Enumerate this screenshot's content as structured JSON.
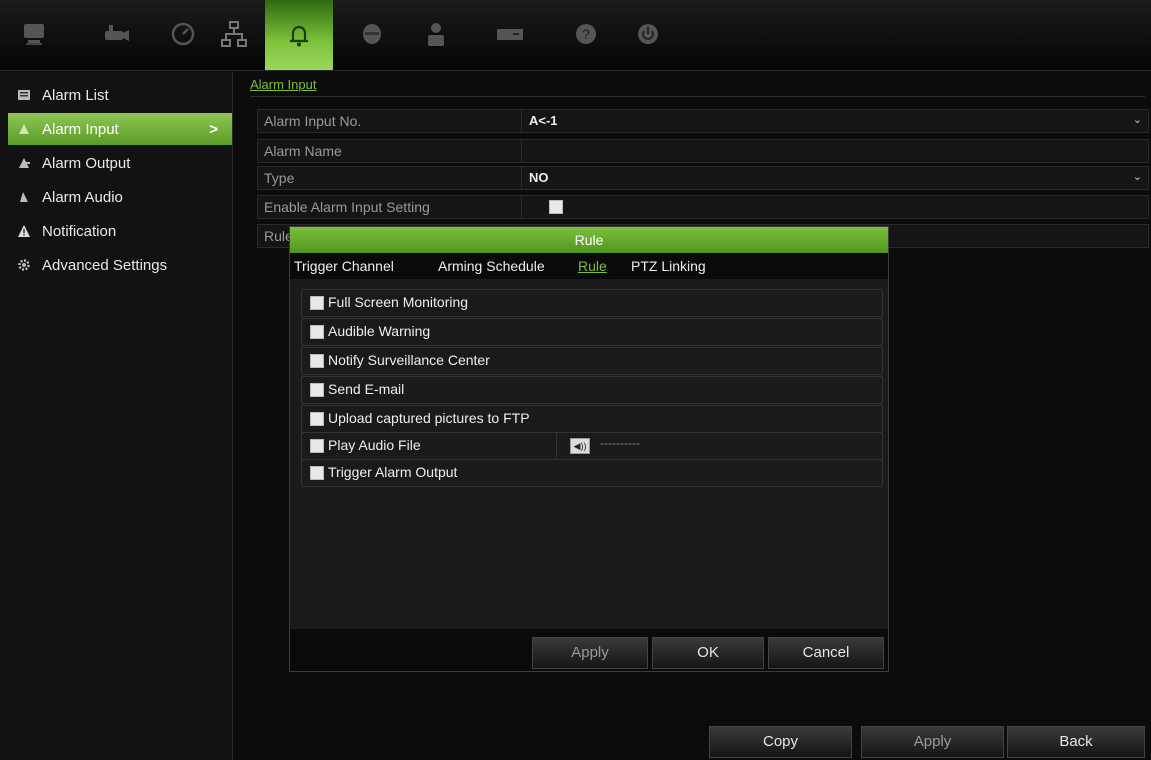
{
  "toolbar": {
    "icons": [
      "monitor-icon",
      "camera-icon",
      "gauge-icon",
      "network-icon",
      "bell-icon",
      "disk-icon",
      "user-icon",
      "storage-icon",
      "help-icon",
      "power-icon"
    ],
    "active_color": "#7dc33a"
  },
  "sidebar": {
    "items": [
      {
        "label": "Alarm List",
        "icon": "alarm-list-icon"
      },
      {
        "label": "Alarm Input",
        "icon": "alarm-input-icon",
        "active": true
      },
      {
        "label": "Alarm Output",
        "icon": "alarm-output-icon"
      },
      {
        "label": "Alarm Audio",
        "icon": "alarm-audio-icon"
      },
      {
        "label": "Notification",
        "icon": "warning-icon"
      },
      {
        "label": "Advanced Settings",
        "icon": "gear-icon"
      }
    ],
    "active_arrow": ">"
  },
  "breadcrumb": "Alarm Input",
  "form": {
    "alarm_input_no_label": "Alarm Input No.",
    "alarm_input_no_value": "A<-1",
    "alarm_name_label": "Alarm Name",
    "alarm_name_value": "",
    "type_label": "Type",
    "type_value": "NO",
    "enable_label": "Enable Alarm Input Setting",
    "rule_label": "Rule"
  },
  "dialog": {
    "title": "Rule",
    "tabs": [
      "Trigger Channel",
      "Arming Schedule",
      "Rule",
      "PTZ Linking"
    ],
    "options": [
      "Full Screen Monitoring",
      "Audible Warning",
      "Notify Surveillance Center",
      "Send E-mail",
      "Upload captured pictures to FTP",
      "Play Audio File",
      "Trigger Alarm Output"
    ],
    "audio_file_value": "----------",
    "apply_label": "Apply",
    "ok_label": "OK",
    "cancel_label": "Cancel"
  },
  "footer": {
    "copy_label": "Copy",
    "apply_label": "Apply",
    "back_label": "Back"
  }
}
